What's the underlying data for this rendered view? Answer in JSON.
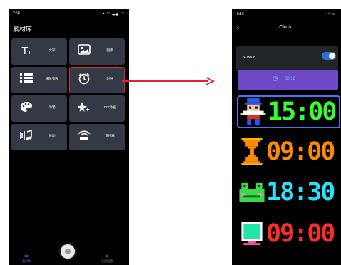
{
  "left_phone": {
    "status_time": "2:58",
    "title": "素材库",
    "tiles": [
      {
        "label": "文字",
        "icon": "text-icon"
      },
      {
        "label": "图库",
        "icon": "image-icon"
      },
      {
        "label": "播放列表",
        "icon": "playlist-icon"
      },
      {
        "label": "时钟",
        "icon": "alarm-clock-icon"
      },
      {
        "label": "涂鸦",
        "icon": "palette-icon"
      },
      {
        "label": "DIY动画",
        "icon": "sparkle-icon"
      },
      {
        "label": "律动",
        "icon": "rhythm-icon"
      },
      {
        "label": "遥控器",
        "icon": "remote-icon"
      }
    ],
    "nav": {
      "home_label": "素材库",
      "settings_label": "系统设置"
    }
  },
  "right_phone": {
    "status_time": "8:16",
    "title": "Clock",
    "hour24_label": "24 Hour",
    "hour24_on": true,
    "sync_time": "08:16",
    "clock_faces": [
      {
        "icon": "pixel-character-icon",
        "time": "15:00",
        "color": "#35ff2e"
      },
      {
        "icon": "hourglass-icon",
        "time": "09:00",
        "color": "#ff8a00"
      },
      {
        "icon": "frog-icon",
        "time": "18:30",
        "color": "#20e6ff"
      },
      {
        "icon": "monitor-icon",
        "time": "09:00",
        "color": "#ff2b2b"
      }
    ]
  },
  "colors": {
    "accent": "#e2203a",
    "blue": "#2d6fd9",
    "purple": "#6f48c9"
  }
}
